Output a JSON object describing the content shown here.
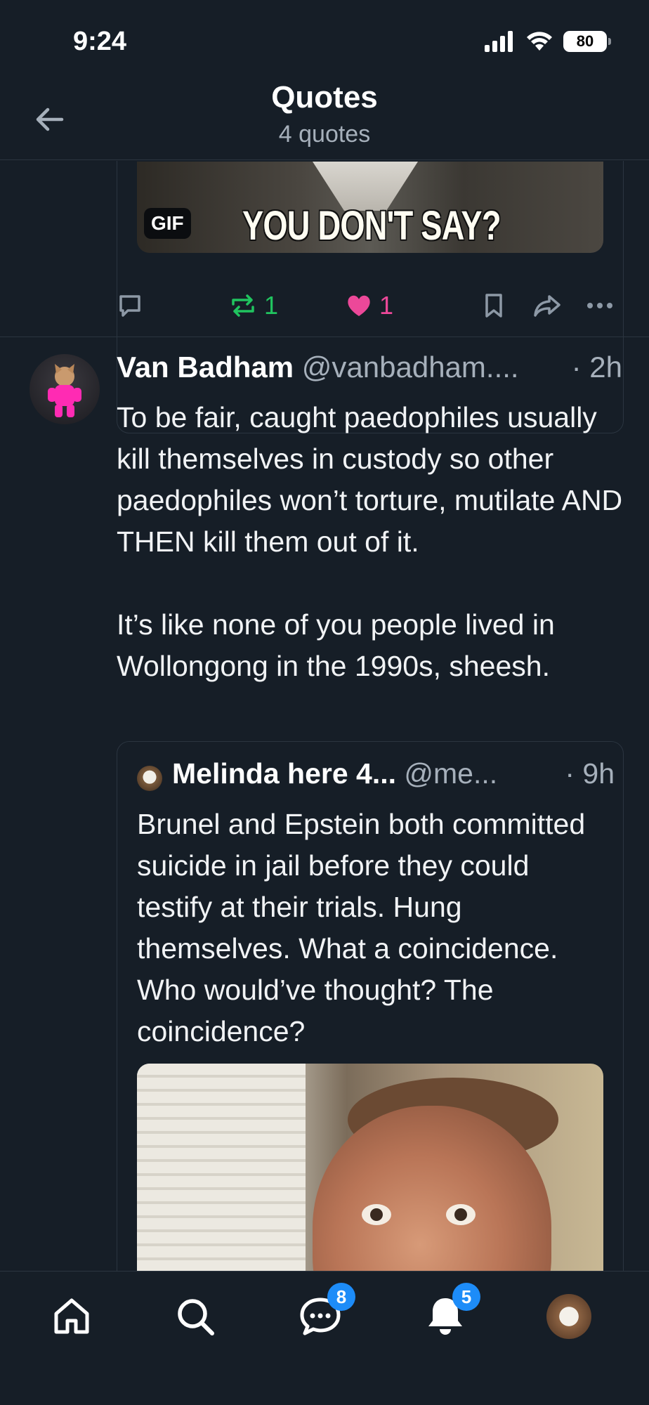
{
  "status_bar": {
    "time": "9:24",
    "battery": "80"
  },
  "header": {
    "title": "Quotes",
    "subtitle": "4 quotes"
  },
  "prev_post": {
    "gif_caption": "YOU DON'T SAY?",
    "gif_badge": "GIF",
    "reposts": "1",
    "likes": "1"
  },
  "post": {
    "author_name": "Van Badham",
    "author_handle": "@vanbadham....",
    "time": "· 2h",
    "body_p1": "To be fair, caught paedophiles usually kill themselves in custody so other paedophiles won’t torture, mutilate AND THEN kill them out of it.",
    "body_p2": "It’s like none of you people lived in Wollongong in the 1990s, sheesh.",
    "quote": {
      "author_name": "Melinda here 4...",
      "author_handle": "@me...",
      "time": "· 9h",
      "body": "Brunel and Epstein both committed suicide in jail before they could testify at their trials. Hung themselves. What a coincidence. Who would’ve thought? The coincidence?"
    }
  },
  "tabbar": {
    "chat_badge": "8",
    "notifications_badge": "5"
  },
  "colors": {
    "background": "#161e27",
    "repost": "#20c45f",
    "like": "#ec4899",
    "badge": "#1d8cf8",
    "muted": "#a6b0bb"
  },
  "icons": [
    "back-arrow-icon",
    "signal-icon",
    "wifi-icon",
    "battery-icon",
    "reply-icon",
    "repost-icon",
    "heart-icon",
    "bookmark-icon",
    "share-icon",
    "more-icon",
    "home-icon",
    "search-icon",
    "chat-icon",
    "bell-icon",
    "profile-avatar"
  ]
}
